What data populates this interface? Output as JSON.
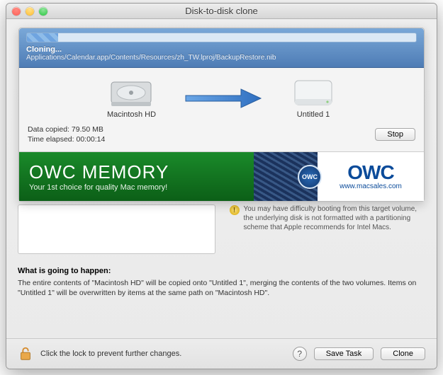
{
  "window": {
    "title": "Disk-to-disk clone"
  },
  "progress": {
    "status": "Cloning...",
    "path": "Applications/Calendar.app/Contents/Resources/zh_TW.lproj/BackupRestore.nib",
    "source_label": "Macintosh HD",
    "target_label": "Untitled 1",
    "data_copied_label": "Data copied:",
    "data_copied_value": "79.50 MB",
    "time_elapsed_label": "Time elapsed:",
    "time_elapsed_value": "00:00:14",
    "stop_label": "Stop"
  },
  "ad": {
    "title": "OWC MEMORY",
    "subtitle": "Your 1st choice for quality Mac memory!",
    "seal": "OWC",
    "logo": "OWC",
    "url": "www.macsales.com"
  },
  "warning": "You may have difficulty booting from this target volume, the underlying disk is not formatted with a partitioning scheme that Apple recommends for Intel Macs.",
  "whats_heading": "What is going to happen:",
  "whats_body": "The entire contents of \"Macintosh HD\" will be copied onto \"Untitled 1\", merging the contents of the two volumes. Items on \"Untitled 1\" will be overwritten by items at the same path on \"Macintosh HD\".",
  "footer": {
    "lock_text": "Click the lock to prevent further changes.",
    "save_task": "Save Task",
    "clone": "Clone"
  }
}
